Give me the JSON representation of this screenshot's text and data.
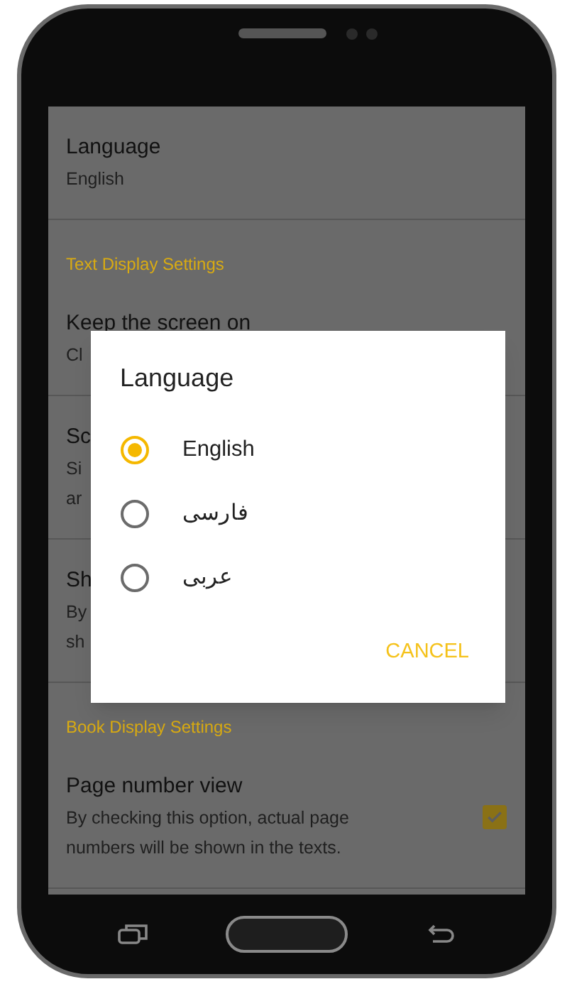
{
  "settings_items": [
    {
      "kind": "item",
      "title": "Language",
      "lines": [
        "English"
      ]
    },
    {
      "kind": "header",
      "title": "Text Display Settings"
    },
    {
      "kind": "item",
      "title": "Keep the screen on",
      "lines": [
        "Cl"
      ]
    },
    {
      "kind": "item",
      "title": "Sc",
      "lines": [
        "Si",
        "ar"
      ]
    },
    {
      "kind": "item",
      "title": "Sh",
      "lines": [
        "By",
        "sh"
      ]
    },
    {
      "kind": "header",
      "title": "Book Display Settings"
    },
    {
      "kind": "check",
      "title": "Page number view",
      "lines": [
        "By checking this option, actual page",
        "numbers will be shown in the texts."
      ],
      "checked": true
    }
  ],
  "dialog": {
    "title": "Language",
    "options": [
      {
        "label": "English",
        "selected": true
      },
      {
        "label": "فارسی",
        "selected": false
      },
      {
        "label": "عربی",
        "selected": false
      }
    ],
    "button": "CANCEL"
  }
}
